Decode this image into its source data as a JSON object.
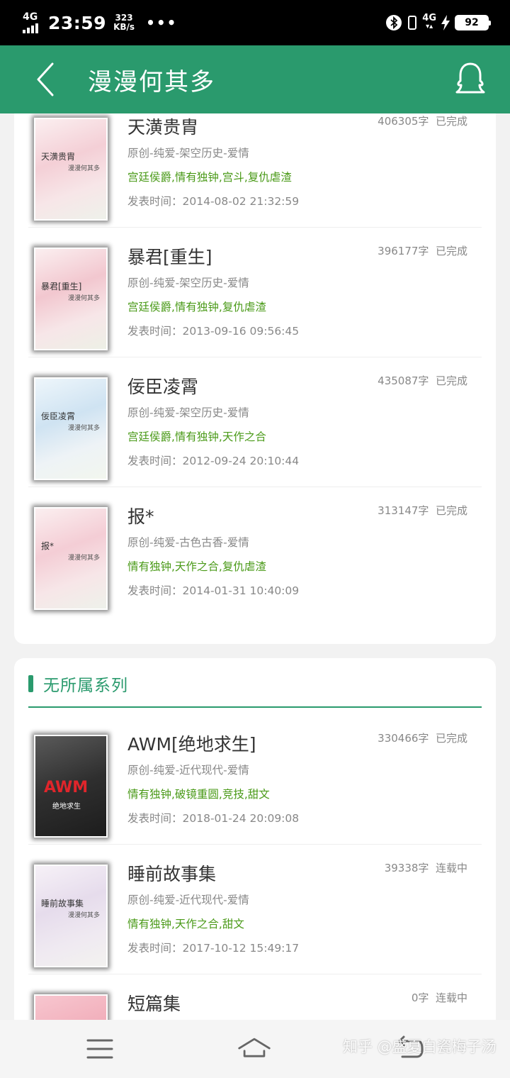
{
  "status_bar": {
    "network": "4G",
    "time": "23:59",
    "speed_value": "323",
    "speed_unit": "KB/s",
    "dots": "•••",
    "network_right": "4G",
    "battery": "92"
  },
  "header": {
    "title": "漫漫何其多"
  },
  "series1": {
    "books": [
      {
        "title": "天潢贵胄",
        "words": "406305字",
        "status": "已完成",
        "category": "原创-纯爱-架空历史-爱情",
        "tags": "宫廷侯爵,情有独钟,宫斗,复仇虐渣",
        "date": "发表时间：2014-08-02 21:32:59",
        "cover_title": "天潢贵胄",
        "cover_author": "漫漫何其多"
      },
      {
        "title": "暴君[重生]",
        "words": "396177字",
        "status": "已完成",
        "category": "原创-纯爱-架空历史-爱情",
        "tags": "宫廷侯爵,情有独钟,复仇虐渣",
        "date": "发表时间：2013-09-16 09:56:45",
        "cover_title": "暴君[重生]",
        "cover_author": "漫漫何其多"
      },
      {
        "title": "佞臣凌霄",
        "words": "435087字",
        "status": "已完成",
        "category": "原创-纯爱-架空历史-爱情",
        "tags": "宫廷侯爵,情有独钟,天作之合",
        "date": "发表时间：2012-09-24 20:10:44",
        "cover_title": "佞臣凌霄",
        "cover_author": "漫漫何其多"
      },
      {
        "title": "报*",
        "words": "313147字",
        "status": "已完成",
        "category": "原创-纯爱-古色古香-爱情",
        "tags": "情有独钟,天作之合,复仇虐渣",
        "date": "发表时间：2014-01-31 10:40:09",
        "cover_title": "报*",
        "cover_author": "漫漫何其多"
      }
    ]
  },
  "series2": {
    "title": "无所属系列",
    "books": [
      {
        "title": "AWM[绝地求生]",
        "words": "330466字",
        "status": "已完成",
        "category": "原创-纯爱-近代现代-爱情",
        "tags": "情有独钟,破镜重圆,竞技,甜文",
        "date": "发表时间：2018-01-24 20:09:08",
        "cover_title": "AWM",
        "cover_author": "绝地求生"
      },
      {
        "title": "睡前故事集",
        "words": "39338字",
        "status": "连载中",
        "category": "原创-纯爱-近代现代-爱情",
        "tags": "情有独钟,天作之合,甜文",
        "date": "发表时间：2017-10-12 15:49:17",
        "cover_title": "睡前故事集",
        "cover_author": "漫漫何其多"
      },
      {
        "title": "短篇集",
        "words": "0字",
        "status": "连载中"
      }
    ]
  },
  "watermark": "知乎 @盛夏白瓷梅子汤",
  "colors": {
    "brand": "#2a9a6d",
    "tag": "#4a9a18"
  }
}
